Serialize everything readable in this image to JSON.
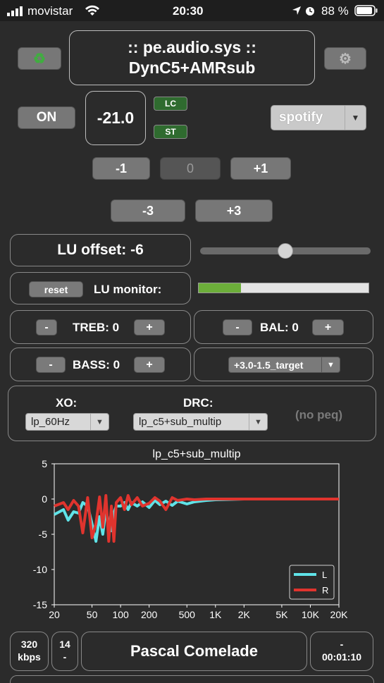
{
  "status_bar": {
    "carrier": "movistar",
    "time": "20:30",
    "battery_pct": "88 %"
  },
  "header": {
    "title_line1": ":: pe.audio.sys ::",
    "title_line2": "DynC5+AMRsub"
  },
  "power": {
    "label": "ON"
  },
  "volume": {
    "value": "-21.0"
  },
  "badges": {
    "lc": "LC",
    "st": "ST"
  },
  "source": {
    "selected": "spotify"
  },
  "volume_buttons": {
    "minus1": "-1",
    "zero": "0",
    "plus1": "+1",
    "minus3": "-3",
    "plus3": "+3"
  },
  "lu": {
    "offset_label": "LU offset: -6",
    "slider_level": 0.5,
    "reset_label": "reset",
    "monitor_label": "LU monitor:",
    "monitor_level": 0.25
  },
  "tone": {
    "treble_label": "TREB: 0",
    "bass_label": "BASS: 0",
    "balance_label": "BAL: 0",
    "minus": "-",
    "plus": "+",
    "target": "+3.0-1.5_target"
  },
  "xo_drc": {
    "xo_label": "XO:",
    "xo_selected": "lp_60Hz",
    "drc_label": "DRC:",
    "drc_selected": "lp_c5+sub_multip",
    "peq": "(no peq)"
  },
  "chart_data": {
    "type": "line",
    "title": "lp_c5+sub_multip",
    "xlabel": "",
    "ylabel": "",
    "x_scale": "log",
    "xlim": [
      20,
      20000
    ],
    "ylim": [
      -15,
      5
    ],
    "x_ticks": [
      "20",
      "50",
      "100",
      "200",
      "500",
      "1K",
      "2K",
      "5K",
      "10K",
      "20K"
    ],
    "y_ticks": [
      "5",
      "0",
      "-5",
      "-10",
      "-15"
    ],
    "legend_position": "bottom-right",
    "series": [
      {
        "name": "L",
        "color": "#5fe3e8",
        "x": [
          20,
          25,
          28,
          32,
          36,
          40,
          45,
          50,
          55,
          60,
          65,
          70,
          75,
          80,
          85,
          90,
          100,
          110,
          120,
          130,
          150,
          170,
          200,
          230,
          260,
          300,
          350,
          400,
          500,
          600,
          800,
          1000,
          2000,
          5000,
          10000,
          20000
        ],
        "y": [
          -2.2,
          -1.5,
          -3.0,
          -1.8,
          -2.0,
          -0.5,
          -1.0,
          -3.5,
          -6.0,
          -2.5,
          -5.0,
          -1.5,
          -3.5,
          -4.5,
          -2.0,
          -1.0,
          -1.0,
          -0.5,
          -1.5,
          -0.5,
          -1.0,
          -0.4,
          -1.2,
          -0.2,
          -0.8,
          -0.3,
          -0.9,
          -0.3,
          -0.7,
          -0.4,
          -0.2,
          -0.1,
          0,
          0,
          0,
          0
        ]
      },
      {
        "name": "R",
        "color": "#e0342e",
        "x": [
          20,
          25,
          28,
          32,
          36,
          40,
          45,
          50,
          55,
          60,
          65,
          70,
          75,
          80,
          85,
          90,
          100,
          110,
          120,
          130,
          150,
          170,
          200,
          230,
          260,
          300,
          350,
          400,
          500,
          600,
          800,
          1000,
          2000,
          5000,
          10000,
          20000
        ],
        "y": [
          -1.0,
          -0.5,
          -1.5,
          -0.2,
          -1.0,
          -4.8,
          0.2,
          -5.5,
          -3.5,
          0.3,
          -4.0,
          0.5,
          -6.0,
          -1.0,
          -6.0,
          -0.5,
          0.2,
          -1.5,
          0.5,
          -0.8,
          0.2,
          -1.0,
          -0.6,
          0.2,
          -0.3,
          -1.5,
          0.2,
          -0.2,
          0.0,
          -0.1,
          0,
          0,
          0,
          0,
          0,
          0
        ]
      }
    ]
  },
  "footer": {
    "bitrate": "320",
    "bitrate_unit": "kbps",
    "track_num": "14",
    "track_sep": "-",
    "artist": "Pascal Comelade",
    "time_top": "-",
    "time": "00:01:10"
  }
}
